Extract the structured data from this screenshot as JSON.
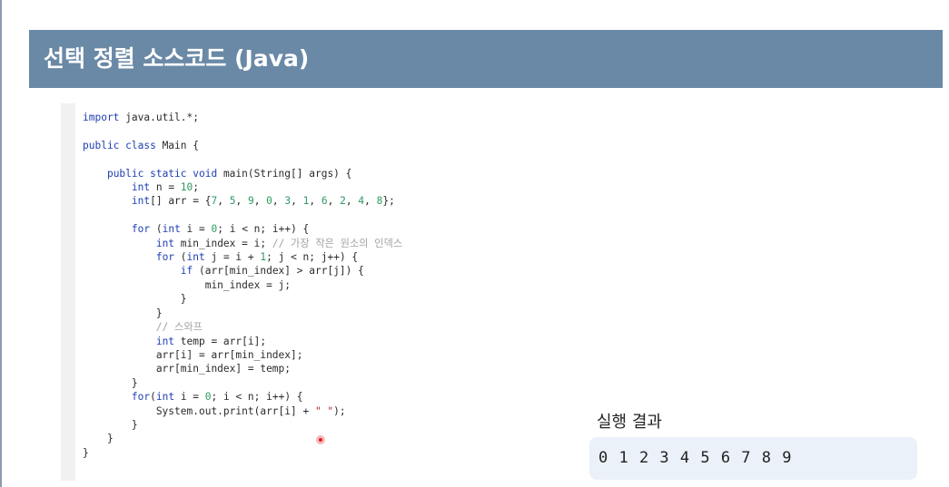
{
  "header": {
    "title": "선택 정렬 소스코드 (Java)"
  },
  "code": {
    "lines": [
      [
        [
          "import",
          "kw"
        ],
        [
          " java.util.*;",
          ""
        ]
      ],
      [],
      [
        [
          "public class",
          "kw"
        ],
        [
          " Main {",
          ""
        ]
      ],
      [],
      [
        [
          "    ",
          ""
        ],
        [
          "public static void",
          "kw"
        ],
        [
          " main(String[] args) {",
          ""
        ]
      ],
      [
        [
          "        ",
          ""
        ],
        [
          "int",
          "kw"
        ],
        [
          " n = ",
          ""
        ],
        [
          "10",
          "num"
        ],
        [
          ";",
          ""
        ]
      ],
      [
        [
          "        ",
          ""
        ],
        [
          "int",
          "kw"
        ],
        [
          "[] arr = {",
          ""
        ],
        [
          "7",
          "num"
        ],
        [
          ", ",
          ""
        ],
        [
          "5",
          "num"
        ],
        [
          ", ",
          ""
        ],
        [
          "9",
          "num"
        ],
        [
          ", ",
          ""
        ],
        [
          "0",
          "num"
        ],
        [
          ", ",
          ""
        ],
        [
          "3",
          "num"
        ],
        [
          ", ",
          ""
        ],
        [
          "1",
          "num"
        ],
        [
          ", ",
          ""
        ],
        [
          "6",
          "num"
        ],
        [
          ", ",
          ""
        ],
        [
          "2",
          "num"
        ],
        [
          ", ",
          ""
        ],
        [
          "4",
          "num"
        ],
        [
          ", ",
          ""
        ],
        [
          "8",
          "num"
        ],
        [
          "};",
          ""
        ]
      ],
      [],
      [
        [
          "        ",
          ""
        ],
        [
          "for",
          "kw"
        ],
        [
          " (",
          ""
        ],
        [
          "int",
          "kw"
        ],
        [
          " i = ",
          ""
        ],
        [
          "0",
          "num"
        ],
        [
          "; i < n; i++) {",
          ""
        ]
      ],
      [
        [
          "            ",
          ""
        ],
        [
          "int",
          "kw"
        ],
        [
          " min_index = i; ",
          ""
        ],
        [
          "// 가장 작은 원소의 인덱스",
          "cmt"
        ]
      ],
      [
        [
          "            ",
          ""
        ],
        [
          "for",
          "kw"
        ],
        [
          " (",
          ""
        ],
        [
          "int",
          "kw"
        ],
        [
          " j = i + ",
          ""
        ],
        [
          "1",
          "num"
        ],
        [
          "; j < n; j++) {",
          ""
        ]
      ],
      [
        [
          "                ",
          ""
        ],
        [
          "if",
          "kw"
        ],
        [
          " (arr[min_index] > arr[j]) {",
          ""
        ]
      ],
      [
        [
          "                    min_index = j;",
          ""
        ]
      ],
      [
        [
          "                }",
          ""
        ]
      ],
      [
        [
          "            }",
          ""
        ]
      ],
      [
        [
          "            ",
          ""
        ],
        [
          "// 스와프",
          "cmt"
        ]
      ],
      [
        [
          "            ",
          ""
        ],
        [
          "int",
          "kw"
        ],
        [
          " temp = arr[i];",
          ""
        ]
      ],
      [
        [
          "            arr[i] = arr[min_index];",
          ""
        ]
      ],
      [
        [
          "            arr[min_index] = temp;",
          ""
        ]
      ],
      [
        [
          "        }",
          ""
        ]
      ],
      [
        [
          "        ",
          ""
        ],
        [
          "for",
          "kw"
        ],
        [
          "(",
          ""
        ],
        [
          "int",
          "kw"
        ],
        [
          " i = ",
          ""
        ],
        [
          "0",
          "num"
        ],
        [
          "; i < n; i++) {",
          ""
        ]
      ],
      [
        [
          "            System.out.print(arr[i] + ",
          ""
        ],
        [
          "\" \"",
          "str"
        ],
        [
          ");",
          ""
        ]
      ],
      [
        [
          "        }",
          ""
        ]
      ],
      [
        [
          "    }",
          ""
        ]
      ],
      [
        [
          "}",
          ""
        ]
      ]
    ]
  },
  "result": {
    "label": "실행 결과",
    "output": "0 1 2 3 4 5 6 7 8 9"
  }
}
